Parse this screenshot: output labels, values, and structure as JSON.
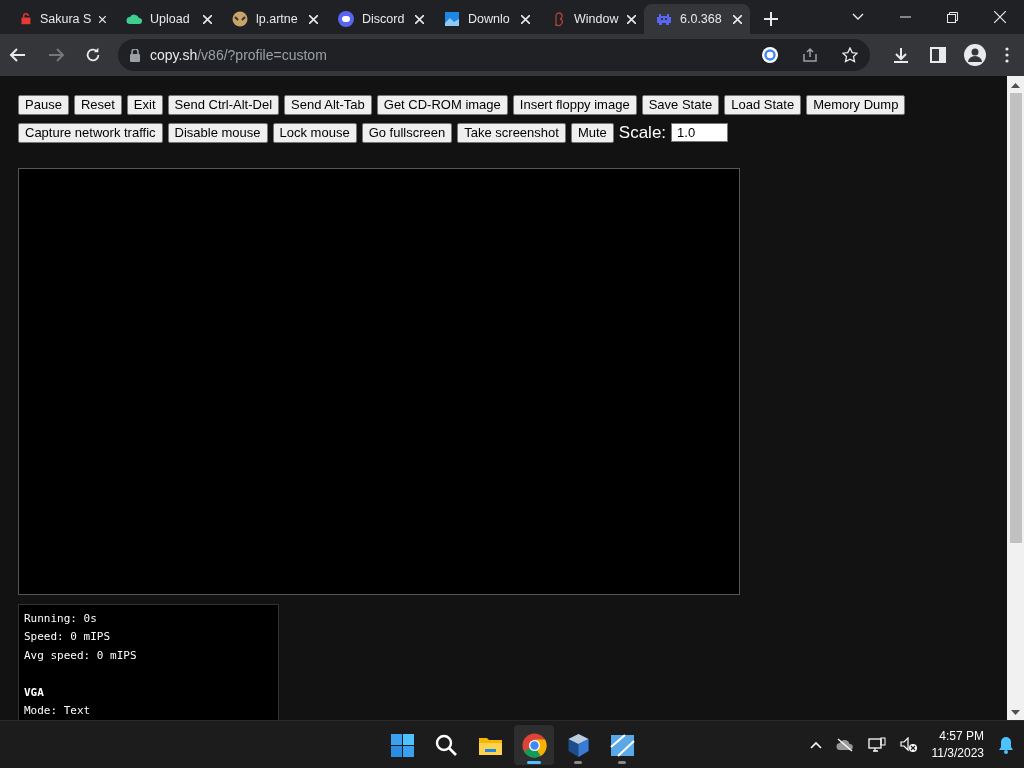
{
  "browser": {
    "tabs": [
      {
        "title": "Sakura S",
        "kind": "lock",
        "selected": false
      },
      {
        "title": "Upload",
        "kind": "cloud",
        "selected": false
      },
      {
        "title": "lp.artne",
        "kind": "mask",
        "selected": false
      },
      {
        "title": "Discord",
        "kind": "chat",
        "selected": false
      },
      {
        "title": "Downlo",
        "kind": "image",
        "selected": false
      },
      {
        "title": "Window",
        "kind": "beta",
        "selected": false
      },
      {
        "title": "6.0.368",
        "kind": "invader",
        "selected": true
      }
    ],
    "address": {
      "host": "copy.sh",
      "path": "/v86/?profile=custom"
    }
  },
  "page": {
    "buttons": [
      "Pause",
      "Reset",
      "Exit",
      "Send Ctrl-Alt-Del",
      "Send Alt-Tab",
      "Get CD-ROM image",
      "Insert floppy image",
      "Save State",
      "Load State",
      "Memory Dump",
      "Capture network traffic",
      "Disable mouse",
      "Lock mouse",
      "Go fullscreen",
      "Take screenshot",
      "Mute"
    ],
    "scale": {
      "label": "Scale:",
      "value": "1.0"
    },
    "stats": [
      "Running: 0s",
      "Speed: 0 mIPS",
      "Avg speed: 0 mIPS"
    ],
    "vga": {
      "heading": "VGA",
      "lines": [
        "Mode: Text"
      ]
    }
  },
  "taskbar": {
    "apps": [
      {
        "kind": "start",
        "selected": false,
        "running": false
      },
      {
        "kind": "search",
        "selected": false,
        "running": false
      },
      {
        "kind": "folder",
        "selected": false,
        "running": false
      },
      {
        "kind": "chrome",
        "selected": true,
        "running": true
      },
      {
        "kind": "cube",
        "selected": false,
        "running": true
      },
      {
        "kind": "tiles",
        "selected": false,
        "running": true
      }
    ],
    "time": "4:57 PM",
    "date": "11/3/2023"
  }
}
